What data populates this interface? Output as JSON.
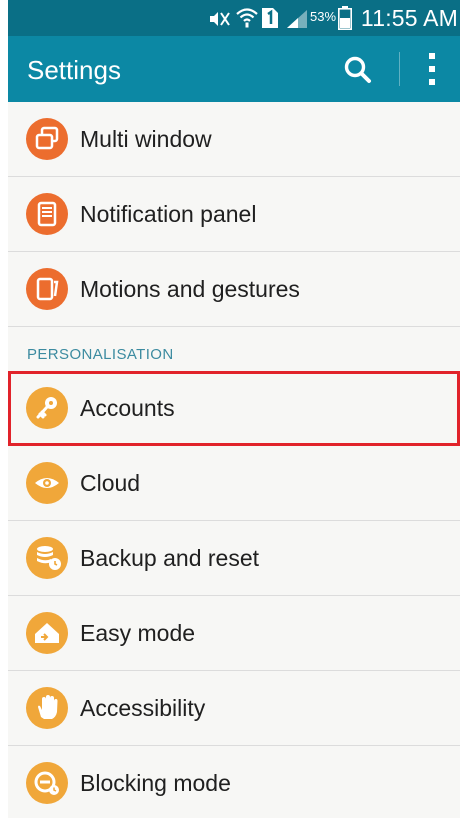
{
  "status_bar": {
    "battery_percent": "53%",
    "time": "11:55 AM",
    "icons": [
      "mute-icon",
      "wifi-icon",
      "sim-icon",
      "signal-icon",
      "battery-icon"
    ]
  },
  "action_bar": {
    "title": "Settings",
    "search_icon": "search-icon",
    "more_icon": "more-vert-icon"
  },
  "colors": {
    "status_bar": "#0a6f86",
    "action_bar": "#0c88a4",
    "orange_dark": "#ec6d2e",
    "orange_light": "#f0a73a",
    "highlight": "#e1232a",
    "section_header": "#3c8ba0"
  },
  "list": {
    "items_top": [
      {
        "label": "Multi window",
        "icon": "multi-window-icon"
      },
      {
        "label": "Notification panel",
        "icon": "notification-panel-icon"
      },
      {
        "label": "Motions and gestures",
        "icon": "motions-icon"
      }
    ],
    "section_header": "PERSONALISATION",
    "items_personalisation": [
      {
        "label": "Accounts",
        "icon": "key-icon",
        "highlighted": true
      },
      {
        "label": "Cloud",
        "icon": "cloud-icon"
      },
      {
        "label": "Backup and reset",
        "icon": "backup-icon"
      },
      {
        "label": "Easy mode",
        "icon": "easy-mode-icon"
      },
      {
        "label": "Accessibility",
        "icon": "hand-icon"
      },
      {
        "label": "Blocking mode",
        "icon": "blocking-mode-icon"
      }
    ]
  }
}
